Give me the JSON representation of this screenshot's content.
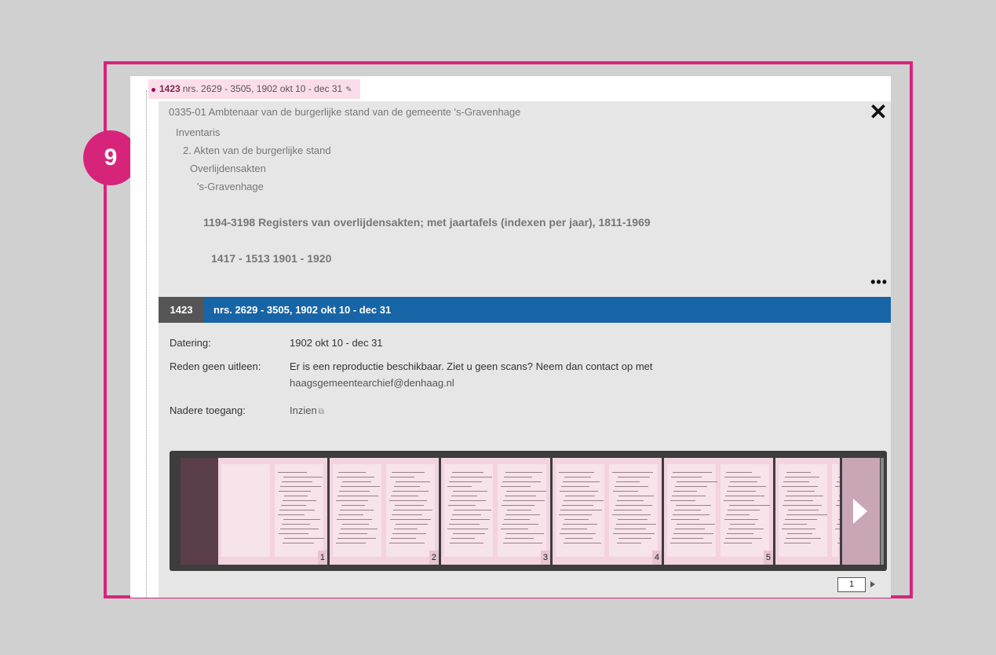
{
  "step_number": "9",
  "tab": {
    "number": "1423",
    "title": "nrs. 2629 - 3505, 1902 okt 10 - dec 31",
    "pin_icon": "paperclip-icon"
  },
  "breadcrumb": {
    "archive": "0335-01 Ambtenaar van de burgerlijke stand van de gemeente 's-Gravenhage",
    "level1": "Inventaris",
    "level2": "2. Akten van de burgerlijke stand",
    "level3": "Overlijdensakten",
    "level4": "'s-Gravenhage",
    "series": "1194-3198 Registers van overlijdensakten; met jaartafels (indexen per jaar), 1811-1969",
    "subseries": "1417 - 1513 1901 - 1920"
  },
  "close_label": "✕",
  "more_label": "•••",
  "record": {
    "number": "1423",
    "title": "nrs. 2629 - 3505, 1902 okt 10 - dec 31",
    "fields": [
      {
        "label": "Datering:",
        "value": "1902 okt 10 - dec 31"
      },
      {
        "label": "Reden geen uitleen:",
        "value": "Er is een reproductie beschikbaar. Ziet u geen scans? Neem dan contact op met",
        "value2": "haagsgemeentearchief@denhaag.nl"
      },
      {
        "label": "Nadere toegang:",
        "value": "Inzien"
      }
    ]
  },
  "viewer": {
    "thumbnails": [
      "1",
      "2",
      "3",
      "4",
      "5"
    ]
  },
  "pager": {
    "current": "1"
  },
  "colors": {
    "accent": "#d6247b",
    "titlebar": "#1765a6"
  }
}
